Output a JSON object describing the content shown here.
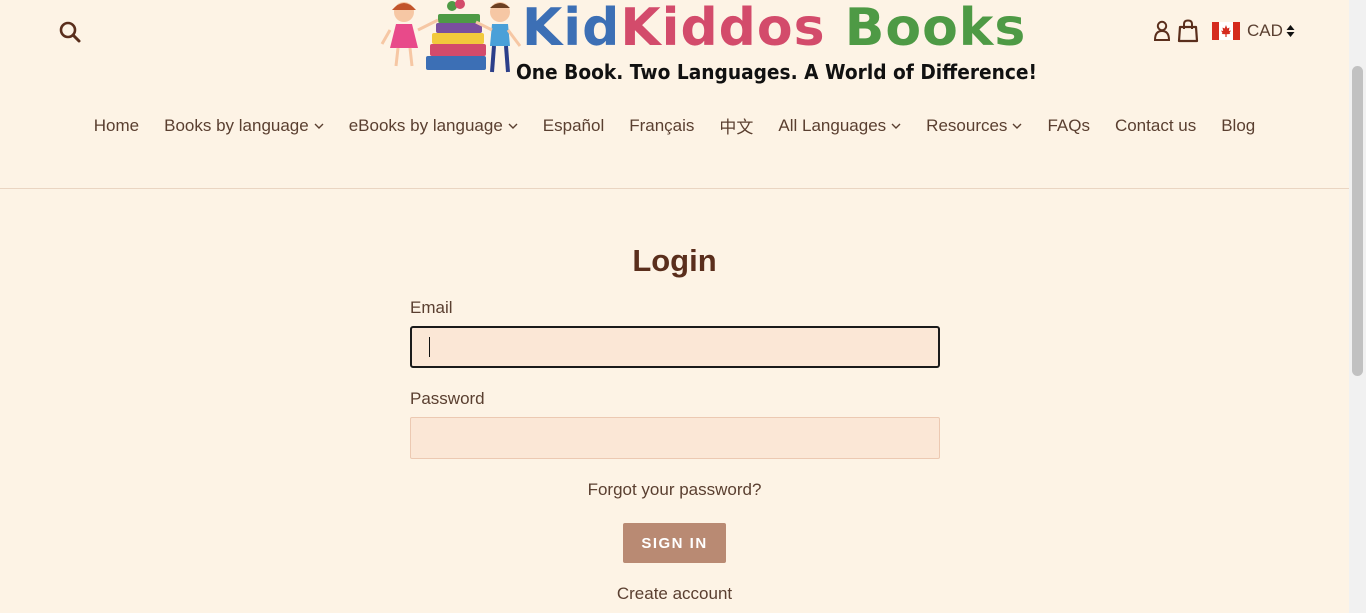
{
  "header": {
    "logo": {
      "title_part1": "Kid",
      "title_part2": "Kiddos",
      "title_part3": "Books",
      "tagline": "One Book. Two Languages. A World of Difference!"
    },
    "currency": {
      "code": "CAD",
      "flag": "canada-flag-icon"
    },
    "icons": {
      "search": "search-icon",
      "account": "user-icon",
      "cart": "cart-icon"
    }
  },
  "nav": {
    "items": [
      {
        "label": "Home",
        "dropdown": false
      },
      {
        "label": "Books by language",
        "dropdown": true
      },
      {
        "label": "eBooks by language",
        "dropdown": true
      },
      {
        "label": "Español",
        "dropdown": false
      },
      {
        "label": "Français",
        "dropdown": false
      },
      {
        "label": "中文",
        "dropdown": false
      },
      {
        "label": "All Languages",
        "dropdown": true
      },
      {
        "label": "Resources",
        "dropdown": true
      },
      {
        "label": "FAQs",
        "dropdown": false
      },
      {
        "label": "Contact us",
        "dropdown": false
      },
      {
        "label": "Blog",
        "dropdown": false
      }
    ]
  },
  "login": {
    "title": "Login",
    "email_label": "Email",
    "email_value": "",
    "password_label": "Password",
    "password_value": "",
    "forgot_label": "Forgot your password?",
    "signin_label": "SIGN IN",
    "create_label": "Create account"
  },
  "colors": {
    "background": "#fdf3e5",
    "text": "#5a3f30",
    "button": "#b98a73",
    "field": "#fbe7d6"
  }
}
